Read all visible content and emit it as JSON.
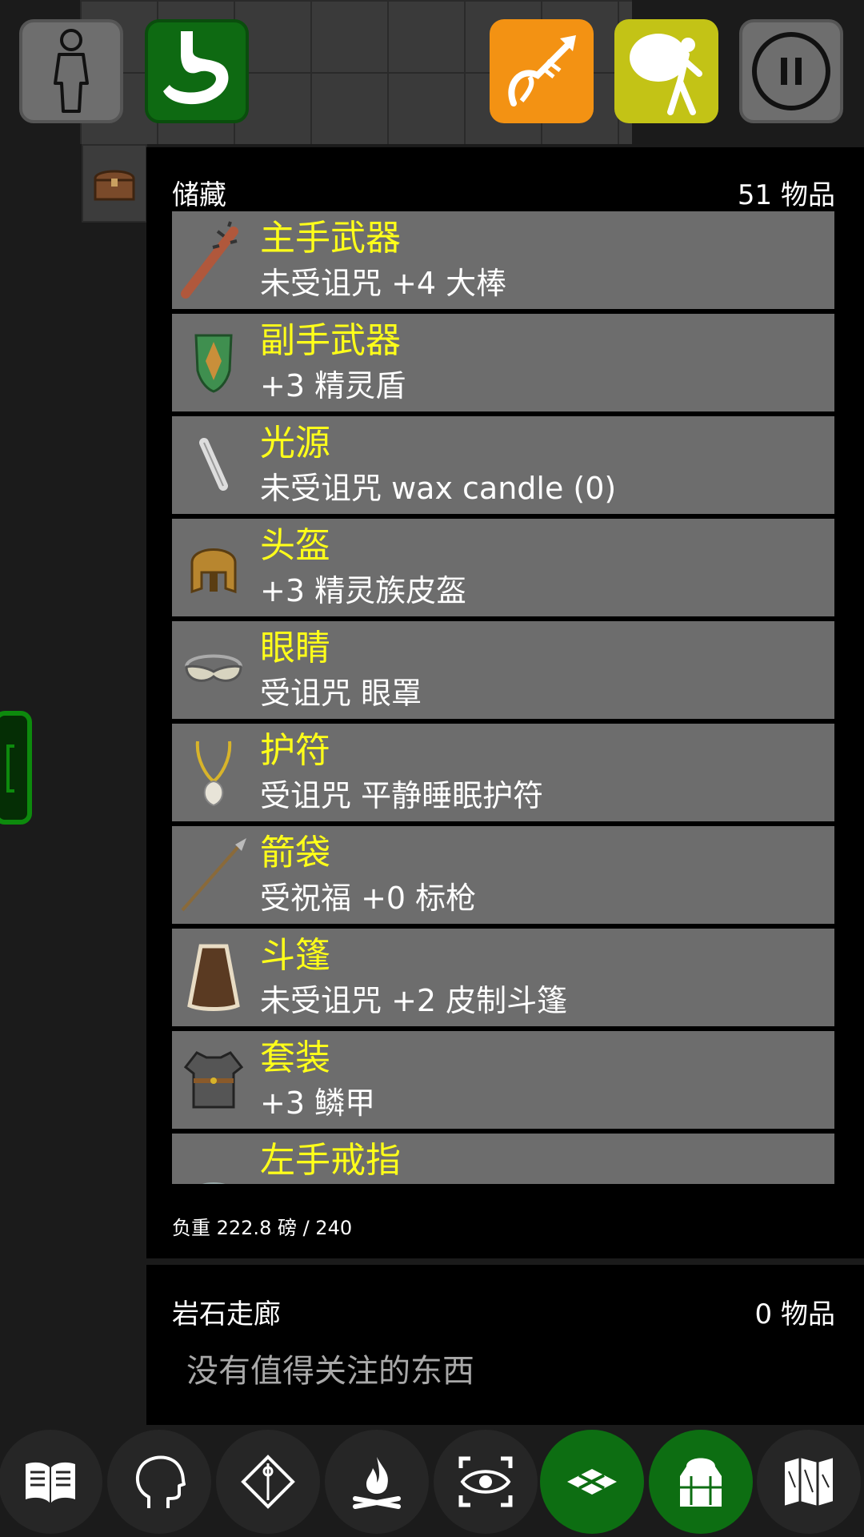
{
  "inventory": {
    "title": "储藏",
    "count": "51 物品",
    "weight": "负重 222.8 磅 / 240",
    "items": [
      {
        "slot": "主手武器",
        "desc": "未受诅咒 +4 大棒",
        "icon": "club-icon"
      },
      {
        "slot": "副手武器",
        "desc": "+3 精灵盾",
        "icon": "elven-shield-icon"
      },
      {
        "slot": "光源",
        "desc": "未受诅咒 wax candle (0)",
        "icon": "candle-icon"
      },
      {
        "slot": "头盔",
        "desc": "+3 精灵族皮盔",
        "icon": "helmet-icon"
      },
      {
        "slot": "眼睛",
        "desc": "受诅咒 眼罩",
        "icon": "blindfold-icon"
      },
      {
        "slot": "护符",
        "desc": "受诅咒 平静睡眠护符",
        "icon": "amulet-icon"
      },
      {
        "slot": "箭袋",
        "desc": "受祝福 +0 标枪",
        "icon": "javelin-icon"
      },
      {
        "slot": "斗篷",
        "desc": "未受诅咒 +2 皮制斗篷",
        "icon": "cloak-icon"
      },
      {
        "slot": "套装",
        "desc": "+3 鳞甲",
        "icon": "scale-mail-icon"
      },
      {
        "slot": "左手戒指",
        "desc": "",
        "icon": "ring-icon"
      }
    ]
  },
  "ground": {
    "title": "岩石走廊",
    "count": "0 物品",
    "empty": "没有值得关注的东西"
  },
  "colors": {
    "accent_green": "#0d6e12",
    "slot_yellow": "#ffff1a",
    "quiver_orange": "#f39213",
    "burden_yellow": "#c3c316"
  }
}
